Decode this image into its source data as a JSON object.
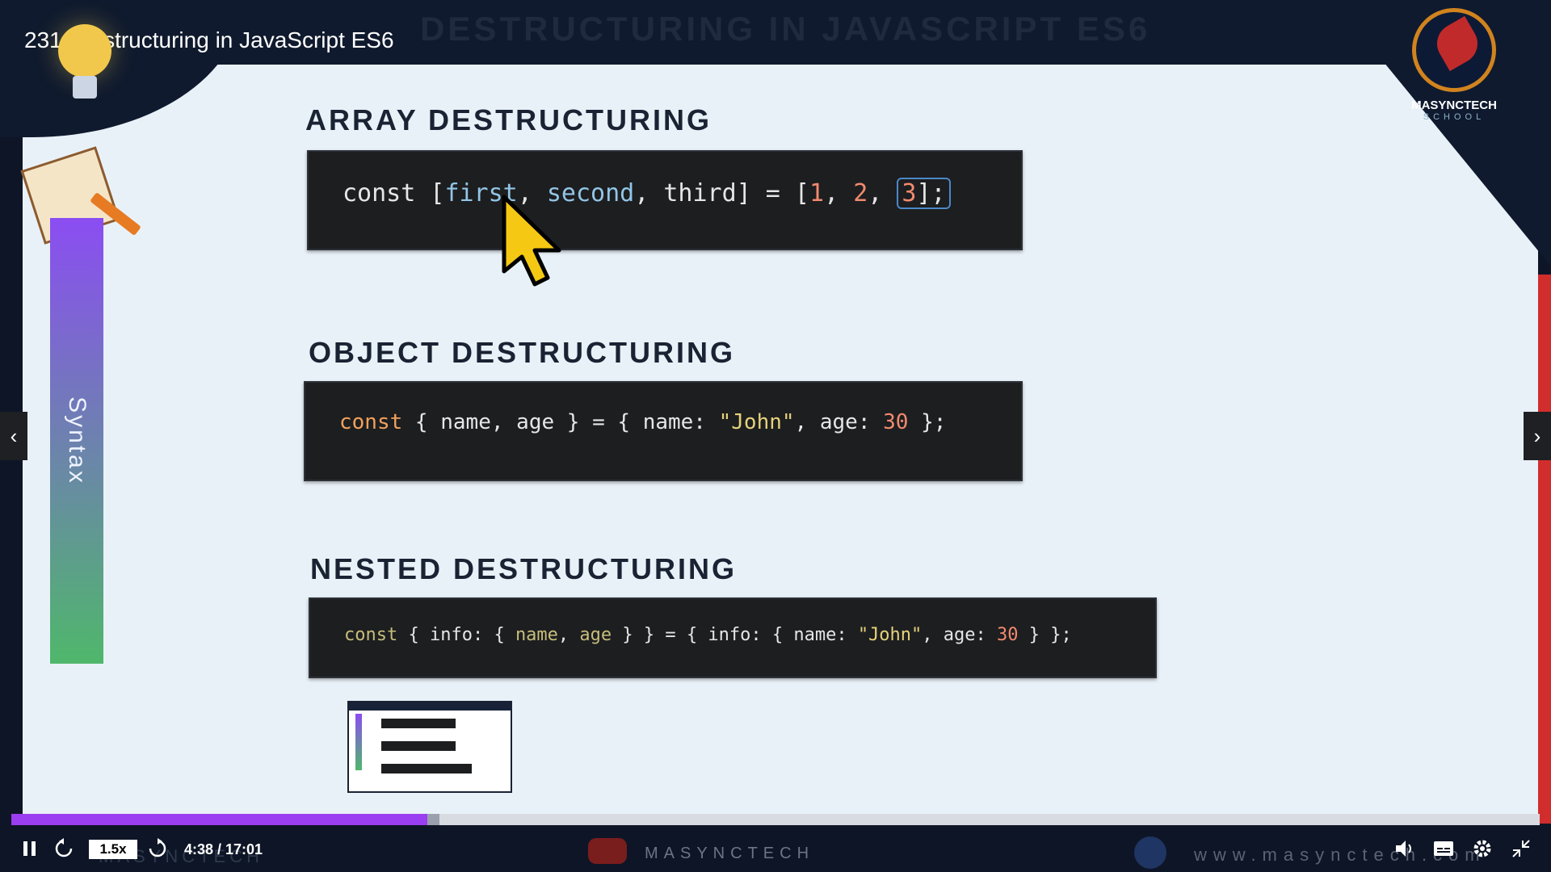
{
  "video": {
    "title": "231. Destructuring in JavaScript ES6"
  },
  "slide": {
    "title": "DESTRUCTURING IN JAVASCRIPT ES6",
    "side_label": "Syntax",
    "sections": [
      {
        "heading": "ARRAY DESTRUCTURING",
        "code": {
          "t1": "const [",
          "v1": "first",
          "t2": ", ",
          "v2": "second",
          "t3": ", ",
          "v3": "third",
          "t4": "] = [",
          "n1": "1",
          "t5": ", ",
          "n2": "2",
          "t6": ", ",
          "n3": "3",
          "t7": "];"
        }
      },
      {
        "heading": "OBJECT DESTRUCTURING",
        "code": {
          "kw": "const",
          "t1": " { name, age } = { name: ",
          "s1": "\"John\"",
          "t2": ", age: ",
          "n1": "30",
          "t3": " };"
        }
      },
      {
        "heading": "NESTED DESTRUCTURING",
        "code": {
          "kw": "const",
          "t1": " { info: { ",
          "v1": "name",
          "t2": ", ",
          "v2": "age",
          "t3": " } } = { info: { name: ",
          "s1": "\"John\"",
          "t4": ", age: ",
          "n1": "30",
          "t5": " } };"
        }
      }
    ],
    "logo": {
      "name": "MASYNCTECH",
      "sub": "SCHOOL"
    }
  },
  "player": {
    "speed": "1.5x",
    "time": "4:38 / 17:01",
    "progress": 0.272,
    "buffered": 0.008,
    "brand_center": "MASYNCTECH",
    "brand_right": "www.masynctech.com",
    "faint_brand": "MASYNCTECH"
  },
  "colors": {
    "accent": "#9b3df0",
    "keyword": "#f2a15c",
    "string": "#e5d27b",
    "number": "#f08a6e",
    "variable": "#92c5e6"
  }
}
